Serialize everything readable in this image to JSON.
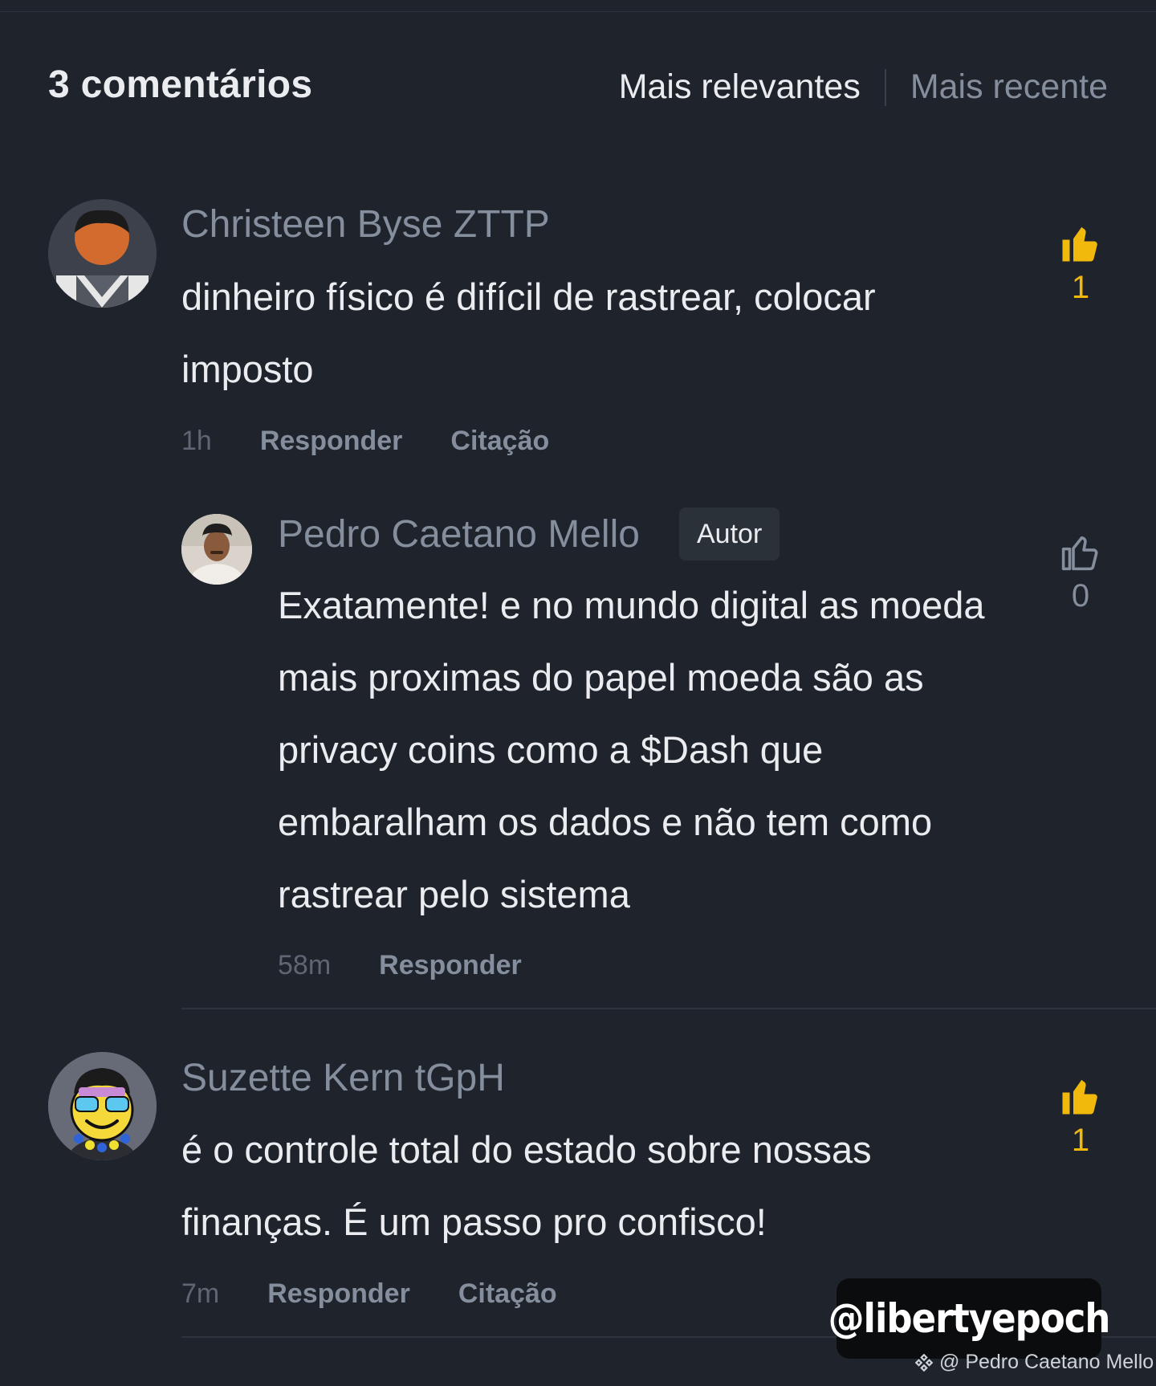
{
  "header": {
    "comment_count": "3 comentários",
    "sort_relevant": "Mais relevantes",
    "sort_recent": "Mais recente"
  },
  "comments": [
    {
      "author": "Christeen Byse ZTTP",
      "text": "dinheiro físico é difícil de rastrear, colocar imposto",
      "time": "1h",
      "reply_label": "Responder",
      "quote_label": "Citação",
      "likes": "1",
      "liked": true,
      "reply": {
        "author": "Pedro Caetano Mello",
        "badge": "Autor",
        "text": "Exatamente! e no mundo digital as moeda mais proximas do papel moeda são as privacy coins como a $Dash que embaralham os dados e não tem como rastrear pelo sistema",
        "time": "58m",
        "reply_label": "Responder",
        "likes": "0",
        "liked": false
      }
    },
    {
      "author": "Suzette Kern tGpH",
      "text": "é o controle total do estado sobre nossas finanças. É um passo pro confisco!",
      "time": "7m",
      "reply_label": "Responder",
      "quote_label": "Citação",
      "likes": "1",
      "liked": true
    }
  ],
  "overlay": {
    "watermark": "@libertyepoch",
    "credit": "@ Pedro Caetano Mello"
  },
  "colors": {
    "background": "#1f232c",
    "accent_like": "#f0b90b",
    "muted_text": "#848e9c",
    "primary_text": "#eaecef"
  },
  "icons": {
    "like_active": "thumbs-up-filled-icon",
    "like_inactive": "thumbs-up-outline-icon"
  }
}
